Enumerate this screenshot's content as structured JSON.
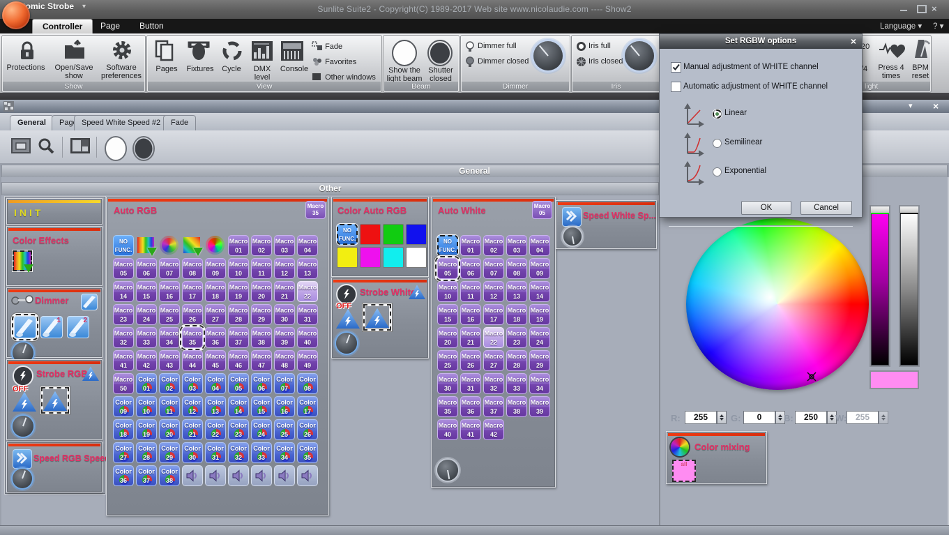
{
  "app": {
    "title": "Sunlite Suite2 - Copyright(C) 1989-2017    Web site www.nicolaudie.com ---- Show2",
    "language_label": "Language",
    "help_label": "?"
  },
  "ui": {
    "caret": "▾",
    "close": "×"
  },
  "ribbon_tabs": [
    {
      "label": "Controller",
      "active": true
    },
    {
      "label": "Page",
      "active": false
    },
    {
      "label": "Button",
      "active": false
    }
  ],
  "ribbon": {
    "show": {
      "label": "Show",
      "protections": "Protections",
      "open_save": "Open/Save show",
      "software_prefs": "Software preferences"
    },
    "view": {
      "label": "View",
      "pages": "Pages",
      "fixtures": "Fixtures",
      "cycle": "Cycle",
      "dmx": "DMX level",
      "console": "Console",
      "fade": "Fade",
      "favorites": "Favorites",
      "other_windows": "Other windows"
    },
    "beam": {
      "label": "Beam",
      "show_beam": "Show the light beam",
      "shutter": "Shutter closed"
    },
    "dimmer": {
      "label": "Dimmer",
      "full": "Dimmer full",
      "closed": "Dimmer closed"
    },
    "iris": {
      "label": "Iris",
      "full": "Iris full",
      "closed": "Iris closed"
    },
    "tempo": {
      "label": "light",
      "bpm_value": "20",
      "beat_value": "/4",
      "press": "Press 4 times",
      "bpm_reset": "BPM reset"
    }
  },
  "dialog": {
    "title": "Set RGBW options",
    "checks": [
      {
        "label": "Manual adjustment of WHITE channel",
        "checked": true
      },
      {
        "label": "Automatic adjustment of WHITE channel",
        "checked": false
      }
    ],
    "radios": [
      {
        "label": "Linear",
        "selected": true
      },
      {
        "label": "Semilinear",
        "selected": false
      },
      {
        "label": "Exponential",
        "selected": false
      }
    ],
    "ok": "OK",
    "cancel": "Cancel"
  },
  "window": {
    "title": "Atomic Strobe",
    "tabs": [
      {
        "label": "General",
        "active": true
      },
      {
        "label": "Page",
        "active": false
      },
      {
        "label": "Speed White Speed #2",
        "active": false
      },
      {
        "label": "Fade",
        "active": false
      }
    ],
    "general_header": "General",
    "other_header": "Other"
  },
  "panels": {
    "init": {
      "title": "INIT"
    },
    "color_effects": {
      "title": "Color Effects"
    },
    "dimmer": {
      "title": "Dimmer",
      "beam_buttons": [
        "",
        "1",
        "2"
      ]
    },
    "strobe_rgb": {
      "title": "Strobe RGB",
      "off": "OFF"
    },
    "speed_rgb": {
      "title": "Speed RGB Speed"
    },
    "auto_rgb": {
      "title": "Auto RGB",
      "badge": [
        "Macro",
        "35"
      ],
      "no_func": [
        "NO",
        "FUNC."
      ],
      "macro_word": "Macro",
      "color_word": "Color",
      "macros": [
        "01",
        "02",
        "03",
        "04",
        "05",
        "06",
        "07",
        "08",
        "09",
        "10",
        "11",
        "12",
        "13",
        "14",
        "15",
        "16",
        "17",
        "18",
        "19",
        "20",
        "21",
        "22",
        "23",
        "24",
        "25",
        "26",
        "27",
        "28",
        "29",
        "30",
        "31",
        "32",
        "33",
        "34",
        "35",
        "36",
        "37",
        "38",
        "39",
        "40",
        "41",
        "42",
        "43",
        "44",
        "45",
        "46",
        "47",
        "48",
        "49",
        "50"
      ],
      "selected_macro": "35",
      "light_macro": "22",
      "colors": [
        "01",
        "02",
        "03",
        "04",
        "05",
        "06",
        "07",
        "08",
        "09",
        "10",
        "11",
        "12",
        "13",
        "14",
        "15",
        "16",
        "17",
        "18",
        "19",
        "20",
        "21",
        "22",
        "23",
        "24",
        "25",
        "26",
        "27",
        "28",
        "29",
        "30",
        "31",
        "32",
        "33",
        "34",
        "35",
        "36",
        "37",
        "38"
      ],
      "speaker_count": 6
    },
    "color_auto_rgb": {
      "title": "Color Auto RGB",
      "no_func": [
        "NO",
        "FUNC."
      ],
      "swatches": [
        "#ee1111",
        "#11cc11",
        "#1111ee",
        "#f2ee11",
        "#ee11ee",
        "#11eeee",
        "#ffffff"
      ]
    },
    "strobe_white": {
      "title": "Strobe White",
      "off": "OFF"
    },
    "auto_white": {
      "title": "Auto White",
      "badge": [
        "Macro",
        "05"
      ],
      "no_func": [
        "NO",
        "FUNC."
      ],
      "macro_word": "Macro",
      "macros": [
        "01",
        "02",
        "03",
        "04",
        "05",
        "06",
        "07",
        "08",
        "09",
        "10",
        "11",
        "12",
        "13",
        "14",
        "15",
        "16",
        "17",
        "18",
        "19",
        "20",
        "21",
        "22",
        "23",
        "24",
        "25",
        "26",
        "27",
        "28",
        "29",
        "30",
        "31",
        "32",
        "33",
        "34",
        "35",
        "36",
        "37",
        "38",
        "39",
        "40",
        "41",
        "42"
      ],
      "selected_macro": "05",
      "light_macro": "22"
    },
    "speed_white": {
      "title": "Speed White Sp..."
    },
    "color_mixing": {
      "title": "Color mixing",
      "swatch_label": "all",
      "swatch_color": "#ff8cf2"
    }
  },
  "picker": {
    "r_label": "R:",
    "g_label": "G:",
    "b_label": "B:",
    "w_label": "W:",
    "r": "255",
    "g": "0",
    "b": "250",
    "w": "255",
    "preview": "#ff8cf2"
  }
}
